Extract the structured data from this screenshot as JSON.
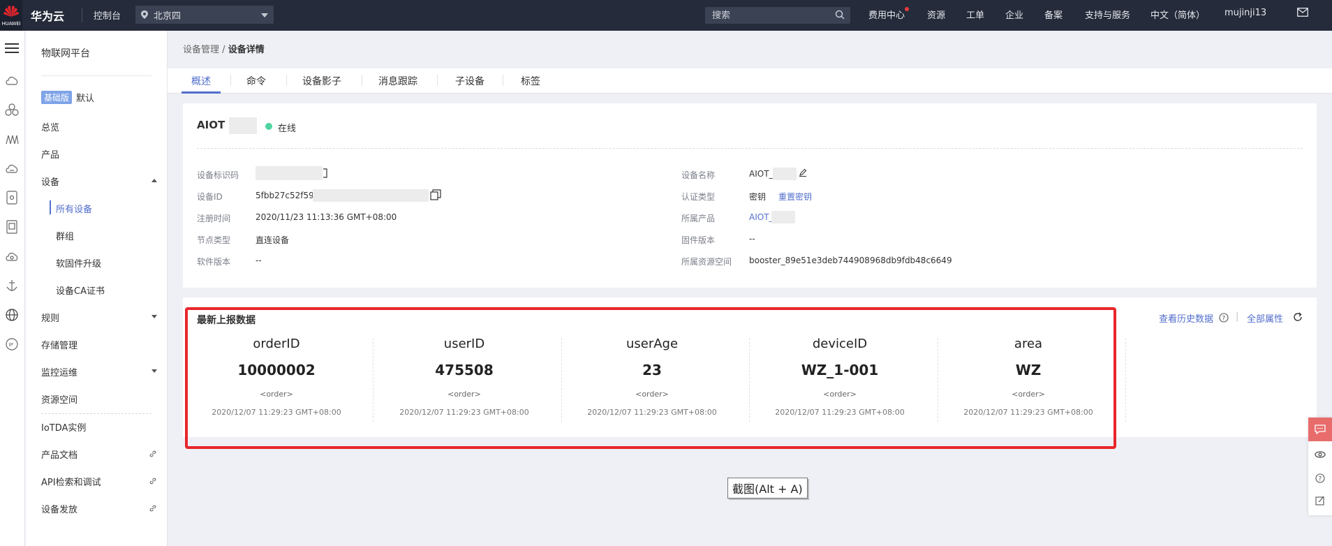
{
  "topbar": {
    "logo_text": "HUAWEI",
    "brand": "华为云",
    "console": "控制台",
    "region": "北京四",
    "search_placeholder": "搜索",
    "nav": [
      "费用中心",
      "资源",
      "工单",
      "企业",
      "备案",
      "支持与服务",
      "中文（简体）",
      "mujinji13"
    ]
  },
  "menu": {
    "title": "物联网平台",
    "edition_badge": "基础版",
    "edition_default": "默认",
    "items": [
      "总览",
      "产品",
      "设备",
      "所有设备",
      "群组",
      "软固件升级",
      "设备CA证书",
      "规则",
      "存储管理",
      "监控运维",
      "资源空间",
      "IoTDA实例",
      "产品文档",
      "API检索和调试",
      "设备发放"
    ]
  },
  "breadcrumb": {
    "parent": "设备管理",
    "sep": "/",
    "current": "设备详情"
  },
  "tabs": [
    "概述",
    "命令",
    "设备影子",
    "消息跟踪",
    "子设备",
    "标签"
  ],
  "device": {
    "name": "AIOT",
    "status": "在线",
    "fields_left": [
      {
        "label": "设备标识码",
        "value": ""
      },
      {
        "label": "设备ID",
        "value": "5fbb27c52f59"
      },
      {
        "label": "注册时间",
        "value": "2020/11/23 11:13:36 GMT+08:00"
      },
      {
        "label": "节点类型",
        "value": "直连设备"
      },
      {
        "label": "软件版本",
        "value": "--"
      }
    ],
    "fields_right": [
      {
        "label": "设备名称",
        "value": "AIOT_"
      },
      {
        "label": "认证类型",
        "value": "密钥",
        "link": "重置密钥"
      },
      {
        "label": "所属产品",
        "value": "AIOT_"
      },
      {
        "label": "固件版本",
        "value": "--"
      },
      {
        "label": "所属资源空间",
        "value": "booster_89e51e3deb744908968db9fdb48c6649"
      }
    ]
  },
  "latest": {
    "title": "最新上报数据",
    "history_link": "查看历史数据",
    "sep": "|",
    "all_props_link": "全部属性",
    "properties": [
      {
        "name": "orderID",
        "value": "10000002",
        "method": "<order>",
        "time": "2020/12/07 11:29:23 GMT+08:00"
      },
      {
        "name": "userID",
        "value": "475508",
        "method": "<order>",
        "time": "2020/12/07 11:29:23 GMT+08:00"
      },
      {
        "name": "userAge",
        "value": "23",
        "method": "<order>",
        "time": "2020/12/07 11:29:23 GMT+08:00"
      },
      {
        "name": "deviceID",
        "value": "WZ_1-001",
        "method": "<order>",
        "time": "2020/12/07 11:29:23 GMT+08:00"
      },
      {
        "name": "area",
        "value": "WZ",
        "method": "<order>",
        "time": "2020/12/07 11:29:23 GMT+08:00"
      }
    ]
  },
  "tooltip": "截图(Alt + A)",
  "colors": {
    "topbar": "#252b3a",
    "accent": "#526ecc",
    "online": "#50d4a0",
    "highlight": "#e8262b"
  }
}
